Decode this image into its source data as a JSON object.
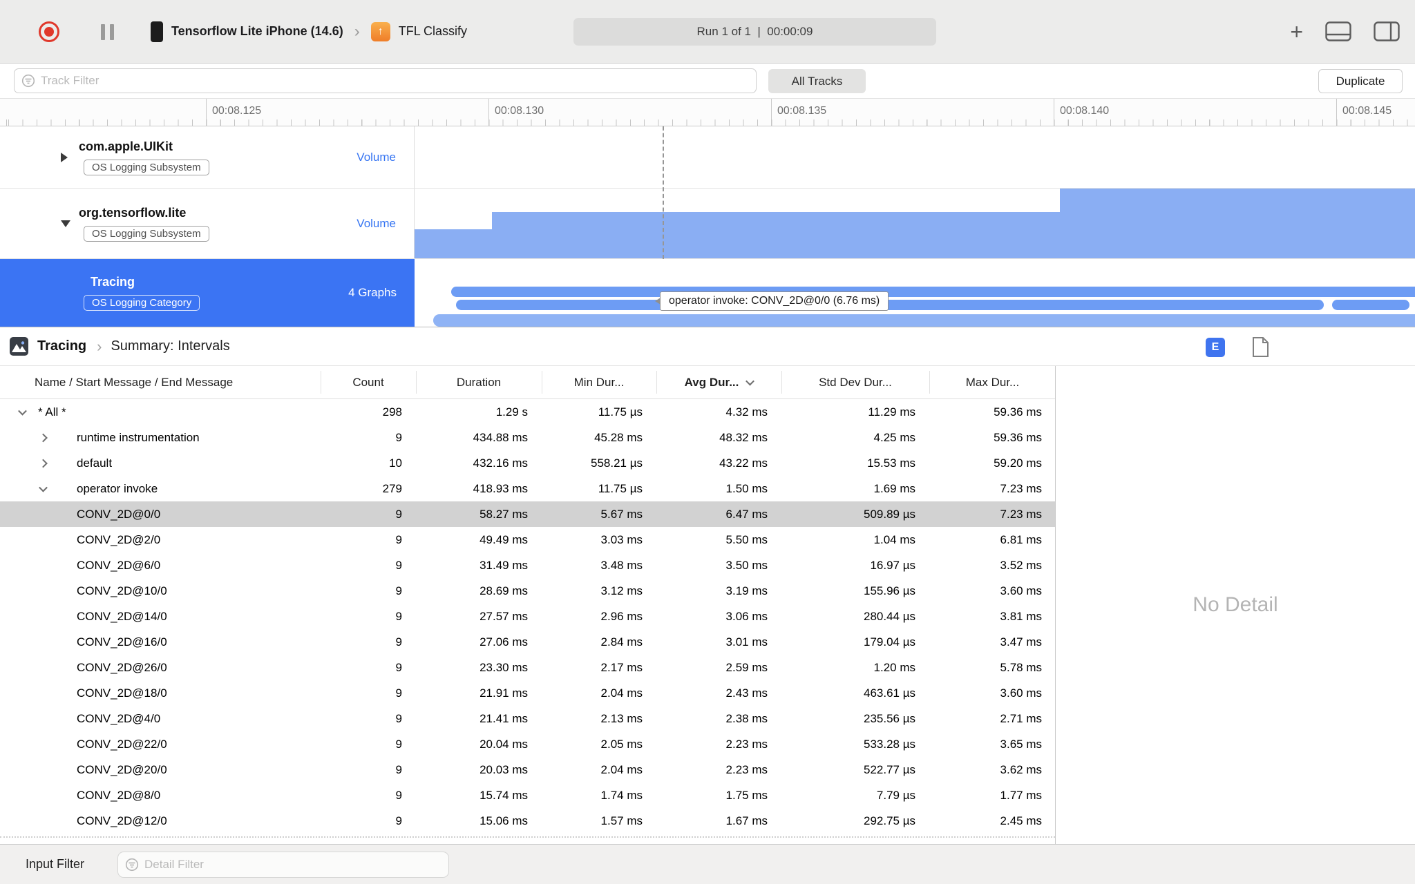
{
  "toolbar": {
    "device_name": "Tensorflow Lite iPhone (14.6)",
    "target_name": "TFL Classify",
    "run_status": "Run 1 of 1  |  00:00:09"
  },
  "filter_bar": {
    "track_filter_placeholder": "Track Filter",
    "all_tracks": "All Tracks",
    "duplicate": "Duplicate"
  },
  "ruler": {
    "labels": [
      "00:08.125",
      "00:08.130",
      "00:08.135",
      "00:08.140",
      "00:08.145"
    ]
  },
  "tracks": [
    {
      "name": "com.apple.UIKit",
      "badge": "OS Logging Subsystem",
      "meta": "Volume",
      "expanded": false,
      "selected": false
    },
    {
      "name": "org.tensorflow.lite",
      "badge": "OS Logging Subsystem",
      "meta": "Volume",
      "expanded": true,
      "selected": false
    },
    {
      "name": "Tracing",
      "badge": "OS Logging Category",
      "meta": "4 Graphs",
      "expanded": true,
      "selected": true
    }
  ],
  "timeline": {
    "tooltip": "operator invoke: CONV_2D@0/0 (6.76 ms)"
  },
  "detail": {
    "breadcrumb": [
      "Tracing",
      "Summary: Intervals"
    ],
    "e_badge": "E",
    "no_detail": "No Detail",
    "table": {
      "columns": [
        "Name / Start Message / End Message",
        "Count",
        "Duration",
        "Min Dur...",
        "Avg Dur...",
        "Std Dev Dur...",
        "Max Dur..."
      ],
      "sorted_column": "Avg Dur...",
      "rows": [
        {
          "name": "* All *",
          "level": 0,
          "chevron": "down",
          "selected": false,
          "values": [
            "298",
            "1.29 s",
            "11.75 µs",
            "4.32 ms",
            "11.29 ms",
            "59.36 ms"
          ]
        },
        {
          "name": "runtime instrumentation",
          "level": 1,
          "chevron": "right",
          "selected": false,
          "values": [
            "9",
            "434.88 ms",
            "45.28 ms",
            "48.32 ms",
            "4.25 ms",
            "59.36 ms"
          ]
        },
        {
          "name": "default",
          "level": 1,
          "chevron": "right",
          "selected": false,
          "values": [
            "10",
            "432.16 ms",
            "558.21 µs",
            "43.22 ms",
            "15.53 ms",
            "59.20 ms"
          ]
        },
        {
          "name": "operator invoke",
          "level": 1,
          "chevron": "down",
          "selected": false,
          "values": [
            "279",
            "418.93 ms",
            "11.75 µs",
            "1.50 ms",
            "1.69 ms",
            "7.23 ms"
          ]
        },
        {
          "name": "CONV_2D@0/0",
          "level": 2,
          "chevron": null,
          "selected": true,
          "values": [
            "9",
            "58.27 ms",
            "5.67 ms",
            "6.47 ms",
            "509.89 µs",
            "7.23 ms"
          ]
        },
        {
          "name": "CONV_2D@2/0",
          "level": 2,
          "chevron": null,
          "selected": false,
          "values": [
            "9",
            "49.49 ms",
            "3.03 ms",
            "5.50 ms",
            "1.04 ms",
            "6.81 ms"
          ]
        },
        {
          "name": "CONV_2D@6/0",
          "level": 2,
          "chevron": null,
          "selected": false,
          "values": [
            "9",
            "31.49 ms",
            "3.48 ms",
            "3.50 ms",
            "16.97 µs",
            "3.52 ms"
          ]
        },
        {
          "name": "CONV_2D@10/0",
          "level": 2,
          "chevron": null,
          "selected": false,
          "values": [
            "9",
            "28.69 ms",
            "3.12 ms",
            "3.19 ms",
            "155.96 µs",
            "3.60 ms"
          ]
        },
        {
          "name": "CONV_2D@14/0",
          "level": 2,
          "chevron": null,
          "selected": false,
          "values": [
            "9",
            "27.57 ms",
            "2.96 ms",
            "3.06 ms",
            "280.44 µs",
            "3.81 ms"
          ]
        },
        {
          "name": "CONV_2D@16/0",
          "level": 2,
          "chevron": null,
          "selected": false,
          "values": [
            "9",
            "27.06 ms",
            "2.84 ms",
            "3.01 ms",
            "179.04 µs",
            "3.47 ms"
          ]
        },
        {
          "name": "CONV_2D@26/0",
          "level": 2,
          "chevron": null,
          "selected": false,
          "values": [
            "9",
            "23.30 ms",
            "2.17 ms",
            "2.59 ms",
            "1.20 ms",
            "5.78 ms"
          ]
        },
        {
          "name": "CONV_2D@18/0",
          "level": 2,
          "chevron": null,
          "selected": false,
          "values": [
            "9",
            "21.91 ms",
            "2.04 ms",
            "2.43 ms",
            "463.61 µs",
            "3.60 ms"
          ]
        },
        {
          "name": "CONV_2D@4/0",
          "level": 2,
          "chevron": null,
          "selected": false,
          "values": [
            "9",
            "21.41 ms",
            "2.13 ms",
            "2.38 ms",
            "235.56 µs",
            "2.71 ms"
          ]
        },
        {
          "name": "CONV_2D@22/0",
          "level": 2,
          "chevron": null,
          "selected": false,
          "values": [
            "9",
            "20.04 ms",
            "2.05 ms",
            "2.23 ms",
            "533.28 µs",
            "3.65 ms"
          ]
        },
        {
          "name": "CONV_2D@20/0",
          "level": 2,
          "chevron": null,
          "selected": false,
          "values": [
            "9",
            "20.03 ms",
            "2.04 ms",
            "2.23 ms",
            "522.77 µs",
            "3.62 ms"
          ]
        },
        {
          "name": "CONV_2D@8/0",
          "level": 2,
          "chevron": null,
          "selected": false,
          "values": [
            "9",
            "15.74 ms",
            "1.74 ms",
            "1.75 ms",
            "7.79 µs",
            "1.77 ms"
          ]
        },
        {
          "name": "CONV_2D@12/0",
          "level": 2,
          "chevron": null,
          "selected": false,
          "values": [
            "9",
            "15.06 ms",
            "1.57 ms",
            "1.67 ms",
            "292.75 µs",
            "2.45 ms"
          ]
        }
      ]
    }
  },
  "bottom_bar": {
    "input_filter_label": "Input Filter",
    "detail_filter_placeholder": "Detail Filter"
  },
  "colors": {
    "accent_blue": "#3b74f3",
    "interval_bar_blue": "#6d9cf4",
    "volume_fill_blue": "#8aaef3",
    "selected_row_gray": "#d2d2d2",
    "record_red": "#e0382b"
  }
}
